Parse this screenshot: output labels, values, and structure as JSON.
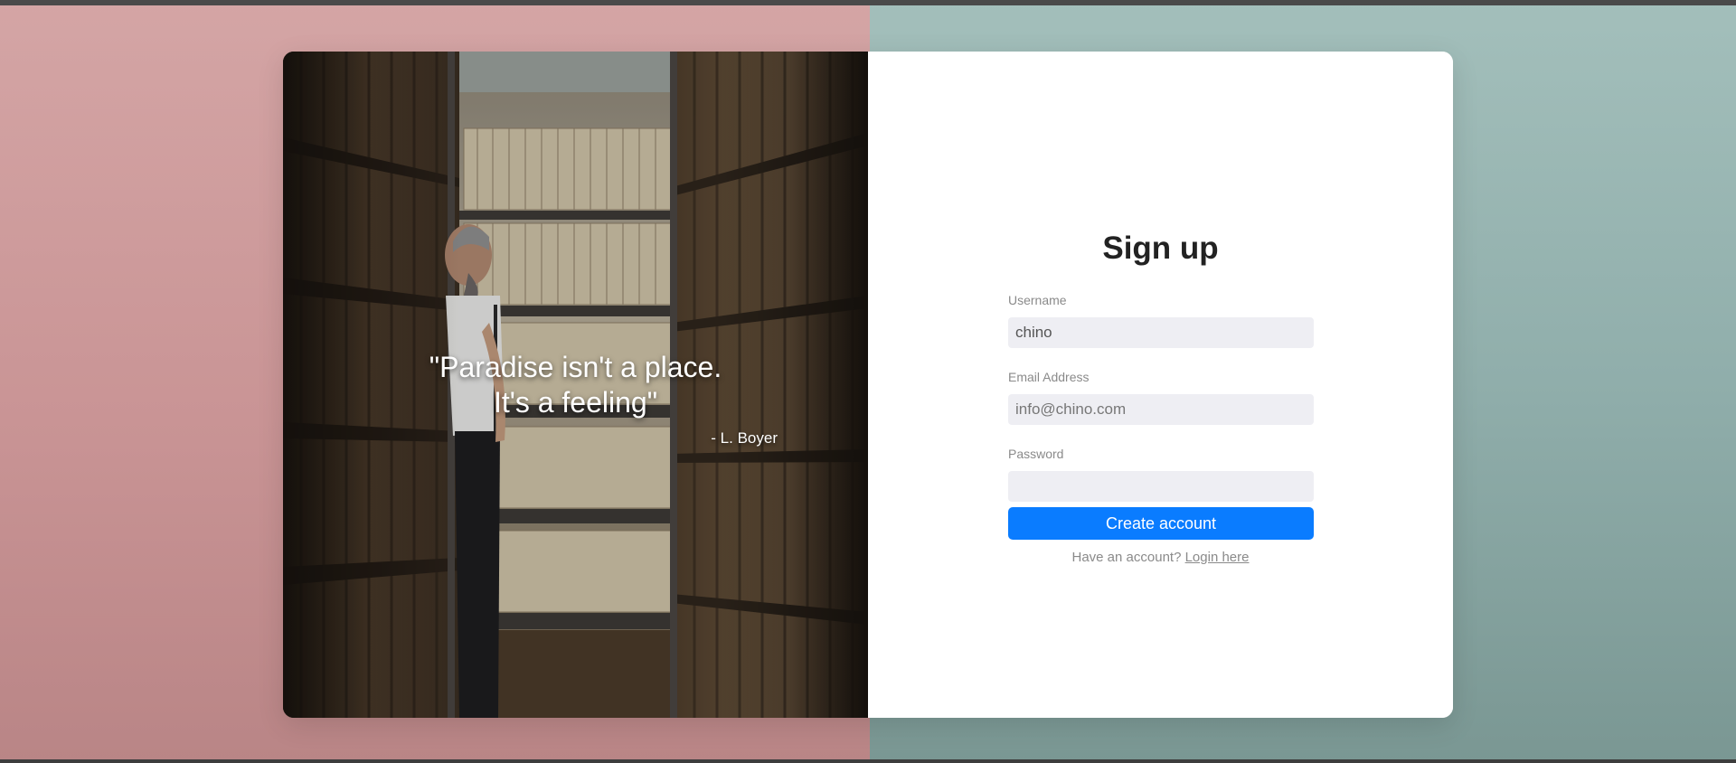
{
  "quote": {
    "line1": "\"Paradise isn't a place.",
    "line2": "It's a feeling\"",
    "author": "- L. Boyer"
  },
  "form": {
    "title": "Sign up",
    "username": {
      "label": "Username",
      "value": "chino",
      "placeholder": ""
    },
    "email": {
      "label": "Email Address",
      "value": "",
      "placeholder": "info@chino.com"
    },
    "password": {
      "label": "Password",
      "value": "",
      "placeholder": ""
    },
    "submit_label": "Create account",
    "login_prompt": "Have an account?",
    "login_link": "Login here"
  },
  "colors": {
    "accent": "#0a7cff",
    "background_left": "#d4a5a5",
    "background_right": "#a3bfbb",
    "input_background": "#eeeef3"
  }
}
